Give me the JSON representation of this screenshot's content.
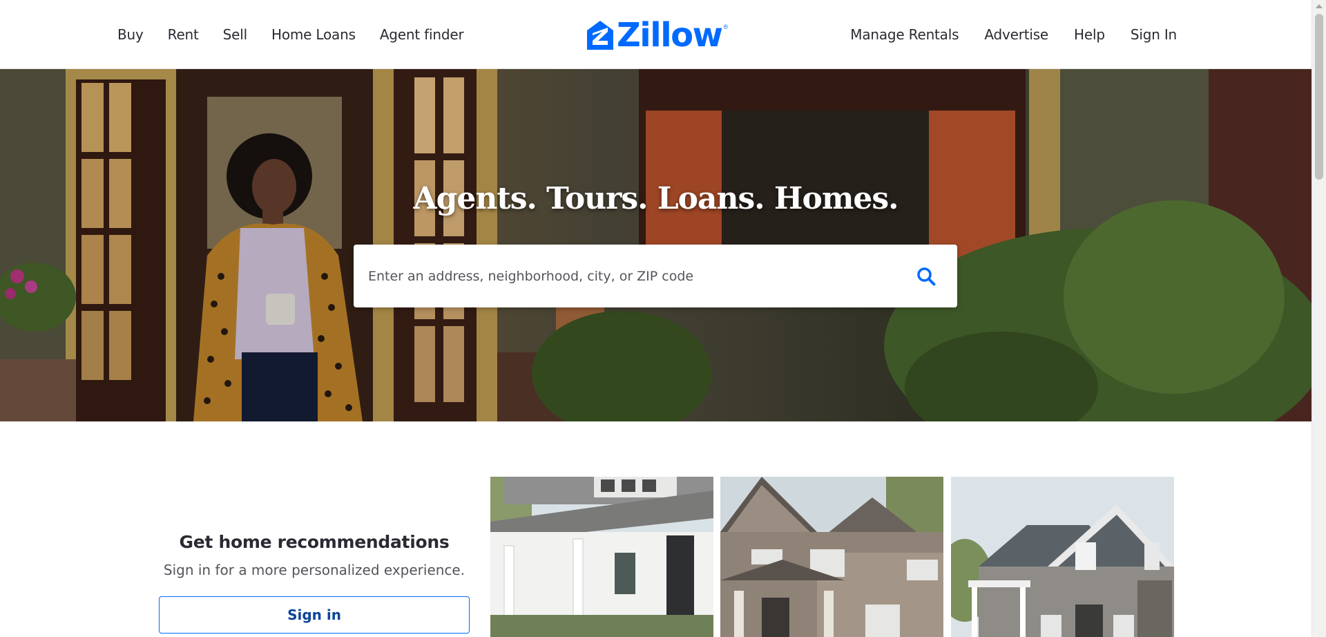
{
  "header": {
    "nav_left": [
      {
        "label": "Buy"
      },
      {
        "label": "Rent"
      },
      {
        "label": "Sell"
      },
      {
        "label": "Home Loans"
      },
      {
        "label": "Agent finder"
      }
    ],
    "logo": {
      "wordmark": "Zillow",
      "registered": "®"
    },
    "nav_right": [
      {
        "label": "Manage Rentals"
      },
      {
        "label": "Advertise"
      },
      {
        "label": "Help"
      },
      {
        "label": "Sign In"
      }
    ]
  },
  "hero": {
    "title": "Agents. Tours. Loans. Homes.",
    "search": {
      "placeholder": "Enter an address, neighborhood, city, or ZIP code",
      "value": "",
      "icon": "search-icon"
    }
  },
  "recommendations": {
    "title": "Get home recommendations",
    "subtitle": "Sign in for a more personalized experience.",
    "signin_label": "Sign in"
  },
  "colors": {
    "brand_blue": "#006aff",
    "text_dark": "#2a2a33",
    "button_text": "#0d4599"
  }
}
